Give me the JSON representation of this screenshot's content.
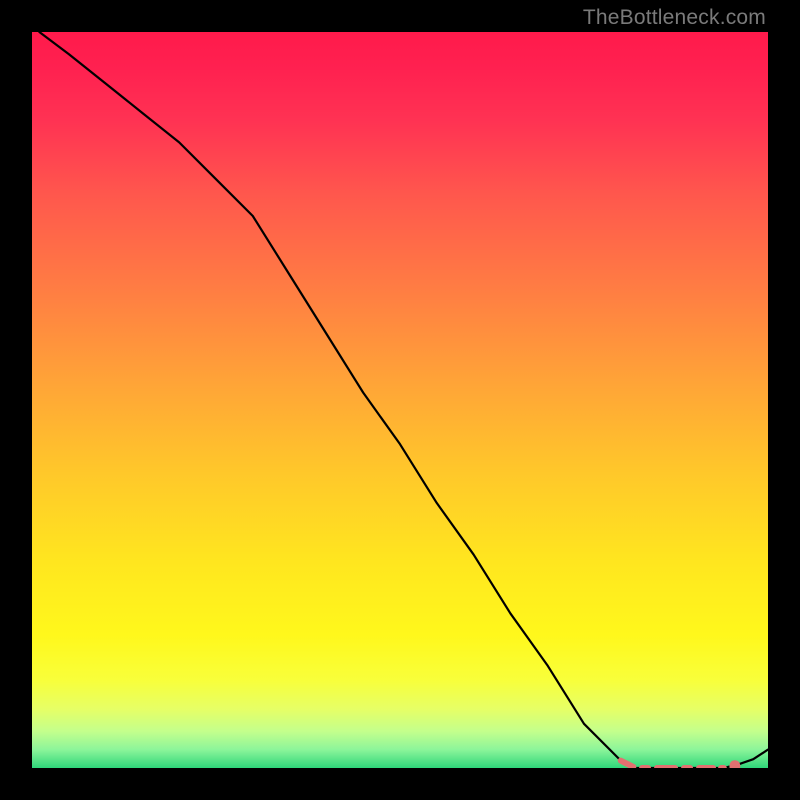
{
  "watermark": "TheBottleneck.com",
  "chart_data": {
    "type": "line",
    "title": "",
    "xlabel": "",
    "ylabel": "",
    "xlim": [
      0,
      100
    ],
    "ylim": [
      0,
      100
    ],
    "grid": false,
    "legend": false,
    "series": [
      {
        "name": "curve",
        "x": [
          1,
          5,
          10,
          15,
          20,
          25,
          30,
          35,
          40,
          45,
          50,
          55,
          60,
          65,
          70,
          75,
          80,
          82,
          85,
          88,
          90,
          92,
          94,
          96,
          98,
          100
        ],
        "y": [
          100,
          97,
          93,
          89,
          85,
          80,
          75,
          67,
          59,
          51,
          44,
          36,
          29,
          21,
          14,
          6,
          1,
          0,
          0,
          0,
          0,
          0,
          0,
          0.5,
          1.2,
          2.5
        ]
      },
      {
        "name": "highlight-dashed",
        "style": "dashed",
        "color": "#e27070",
        "x": [
          80,
          82,
          84,
          86,
          88,
          90,
          92,
          94
        ],
        "y": [
          1,
          0,
          0,
          0,
          0,
          0,
          0,
          0
        ]
      },
      {
        "name": "highlight-dot",
        "style": "point",
        "color": "#e27070",
        "x": [
          95.5
        ],
        "y": [
          0.3
        ]
      }
    ],
    "gradient_stops": [
      {
        "offset": 0.0,
        "color": "#ff1a4b"
      },
      {
        "offset": 0.05,
        "color": "#ff2150"
      },
      {
        "offset": 0.12,
        "color": "#ff3253"
      },
      {
        "offset": 0.22,
        "color": "#ff574d"
      },
      {
        "offset": 0.35,
        "color": "#ff7d43"
      },
      {
        "offset": 0.48,
        "color": "#ffa537"
      },
      {
        "offset": 0.6,
        "color": "#ffc82a"
      },
      {
        "offset": 0.72,
        "color": "#ffe61f"
      },
      {
        "offset": 0.82,
        "color": "#fff81c"
      },
      {
        "offset": 0.88,
        "color": "#f8ff3a"
      },
      {
        "offset": 0.92,
        "color": "#e6ff66"
      },
      {
        "offset": 0.95,
        "color": "#c4ff8c"
      },
      {
        "offset": 0.975,
        "color": "#8cf59a"
      },
      {
        "offset": 1.0,
        "color": "#2fd67a"
      }
    ]
  }
}
